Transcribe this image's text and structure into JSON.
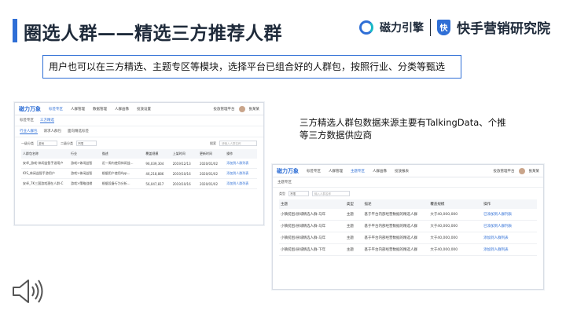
{
  "slide": {
    "title": "圈选人群——精选三方推荐人群",
    "brand": {
      "name": "磁力引擎",
      "shield_text": "快",
      "institute": "快手营销研究院"
    },
    "subtitle": "用户也可以在三方精选、主题专区等模块，选择平台已组合好的人群包，按照行业、分类等甄选",
    "description": "三方精选人群包数据来源主要有TalkingData、个推等三方数据供应商"
  },
  "shot1": {
    "logo": "磁力万象",
    "nav": [
      "标签专区",
      "人群管理",
      "数据管理",
      "人群画像",
      "投放设置"
    ],
    "search": "投放管理平台",
    "user": "张某某",
    "tabs": [
      "标签专区",
      "三方精选"
    ],
    "subtabs": [
      "行业人群包",
      "请求人群包",
      "面向精选标签"
    ],
    "filter": {
      "label1": "一级分类",
      "select1": "游戏",
      "label2": "二级分类",
      "select2": "不限",
      "search_label": "搜索",
      "search_placeholder": "请输入人群名称"
    },
    "table": {
      "headers": [
        "人群包名称",
        "行业",
        "描述",
        "覆盖规模",
        "上架时间",
        "更新时间",
        "操作"
      ],
      "rows": [
        [
          "安卓_游戏-休闲益智手游用户",
          "游戏>休闲益智",
          "近一周内使用休闲益...",
          "96,039,304",
          "2019/12/13",
          "2020/01/02",
          "添加到人群列表"
        ],
        [
          "IOS_休闲益智手游用户",
          "游戏>休闲益智",
          "根据用户使用App...",
          "46,218,886",
          "2019/10/16",
          "2020/01/02",
          "添加到人群列表"
        ],
        [
          "安卓_7K三国游戏潜在人群-C",
          "游戏>策略战棋",
          "根据设备行为分析...",
          "56,047,817",
          "2019/10/16",
          "2020/01/02",
          "添加到人群列表"
        ]
      ]
    }
  },
  "shot2": {
    "logo": "磁力万象",
    "nav": [
      "标签专区",
      "人群管理",
      "主题专区",
      "人群画像",
      "投放报表"
    ],
    "search": "投放管理平台",
    "user": "张某某",
    "section_title": "主题专区",
    "filter": {
      "label": "类型",
      "select": "不限",
      "search_placeholder": "输入人群名称"
    },
    "table": {
      "headers": [
        "主题",
        "类型",
        "描述",
        "覆盖规模",
        "操作"
      ],
      "rows": [
        [
          "小镇贫困/县域精选人群-马年",
          "主题",
          "基于平台内部经营数据的精选人群",
          "大于40,000,000",
          "已添加到人群列表"
        ],
        [
          "小镇贫困/县域精选人群-马年",
          "主题",
          "基于平台内部经营数据的精选人群",
          "大于40,000,000",
          "已添加到人群列表"
        ],
        [
          "小镇贫困/县域精选人群-马年",
          "主题",
          "基于平台内部经营数据的精选人群",
          "大于40,000,000",
          "添加到人群列表"
        ],
        [
          "小镇贫困/县域精选人群-下年",
          "主题",
          "基于平台内部经营数据的精选人群",
          "大于40,000,000",
          "添加到人群列表"
        ]
      ]
    }
  },
  "colors": {
    "accent": "#2f6fd6",
    "title": "#1e2a3a"
  }
}
